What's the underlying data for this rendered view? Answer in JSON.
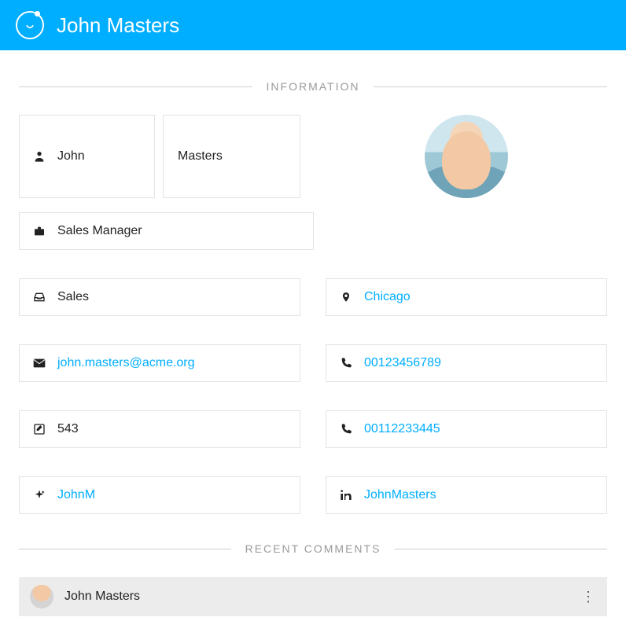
{
  "header": {
    "title": "John Masters"
  },
  "sections": {
    "information": "INFORMATION",
    "recent_comments": "RECENT COMMENTS"
  },
  "info": {
    "first_name": "John",
    "last_name": "Masters",
    "job_title": "Sales Manager",
    "department": "Sales",
    "location": "Chicago",
    "email": "john.masters@acme.org",
    "phone1": "00123456789",
    "extension": "543",
    "phone2": "00112233445",
    "twitter": "JohnM",
    "linkedin": "JohnMasters"
  },
  "comments": [
    {
      "author": "John Masters"
    }
  ]
}
